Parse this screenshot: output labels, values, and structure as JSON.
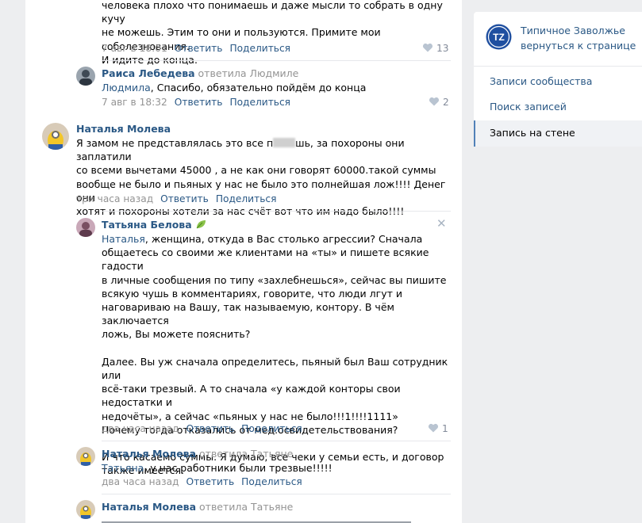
{
  "sidebar": {
    "community_name": "Типичное Заволжье",
    "back_link": "вернуться к странице",
    "logo_text": "TZ",
    "items": [
      {
        "label": "Записи сообщества"
      },
      {
        "label": "Поиск записей"
      },
      {
        "label": "Запись на стене"
      }
    ]
  },
  "comments": [
    {
      "text_lines": [
        "человека плохо что понимаешь и даже мысли то собрать в одну кучу",
        "не можешь. Этим то они и пользуются. Примите мои соболезнования.",
        "И идите до конца."
      ],
      "time": "7 авг в 18:01",
      "reply": "Ответить",
      "share": "Поделиться",
      "likes": "13"
    },
    {
      "author": "Раиса Лебедева",
      "replied_to": "ответила Людмиле",
      "mention": "Людмила",
      "text_rest": ", Спасибо, обязательно пойдём до конца",
      "time": "7 авг в 18:32",
      "reply": "Ответить",
      "share": "Поделиться",
      "likes": "2"
    },
    {
      "author": "Наталья Молева",
      "text_line1_a": "Я замом не представлялась это все п",
      "text_line1_b": "шь, за похороны они заплатили",
      "text_lines": [
        "со всеми вычетами 45000 , а не как они говорят 60000.такой суммы",
        "вообще не было и пьяных у нас не было это полнейшая лож!!!! Денег они",
        "хотят и похороны хотели за нас счёт вот что им надо было!!!!"
      ],
      "time": "три часа назад",
      "reply": "Ответить",
      "share": "Поделиться"
    },
    {
      "author": "Татьяна Белова",
      "mention": "Наталья",
      "text_line1_rest": ", женщина, откуда в Вас столько агрессии? Сначала",
      "text_lines": [
        "общаетесь со своими же клиентами на «ты» и пишете всякие гадости",
        "в личные сообщения по типу «захлебнешься», сейчас вы пишите",
        "всякую чушь в комментариях, говорите, что люди лгут и",
        "наговариваю на Вашу, так называемую, контору. В чём заключается",
        "ложь, Вы можете пояснить?",
        "",
        "Далее. Вы уж сначала определитесь, пьяный был Ваш сотрудник или",
        "всё-таки трезвый. А то сначала «у каждой конторы свои недостатки и",
        "недочёты», а сейчас «пьяных у нас не было!!!1!!!!1111»",
        "Почему тогда отказались от мед.освидетельствования?",
        "",
        "И что касаемо суммы. Я думаю, все чеки у семьи есть, и договор",
        "также имеется."
      ],
      "time": "два часа назад",
      "reply": "Ответить",
      "share": "Поделиться",
      "likes": "1"
    },
    {
      "author": "Наталья Молева",
      "replied_to": "ответила Татьяне",
      "mention": "Татьяна",
      "text_rest": ", у нас работники были трезвые!!!!!",
      "time": "два часа назад",
      "reply": "Ответить",
      "share": "Поделиться"
    },
    {
      "author": "Наталья Молева",
      "replied_to": "ответила Татьяне"
    }
  ]
}
